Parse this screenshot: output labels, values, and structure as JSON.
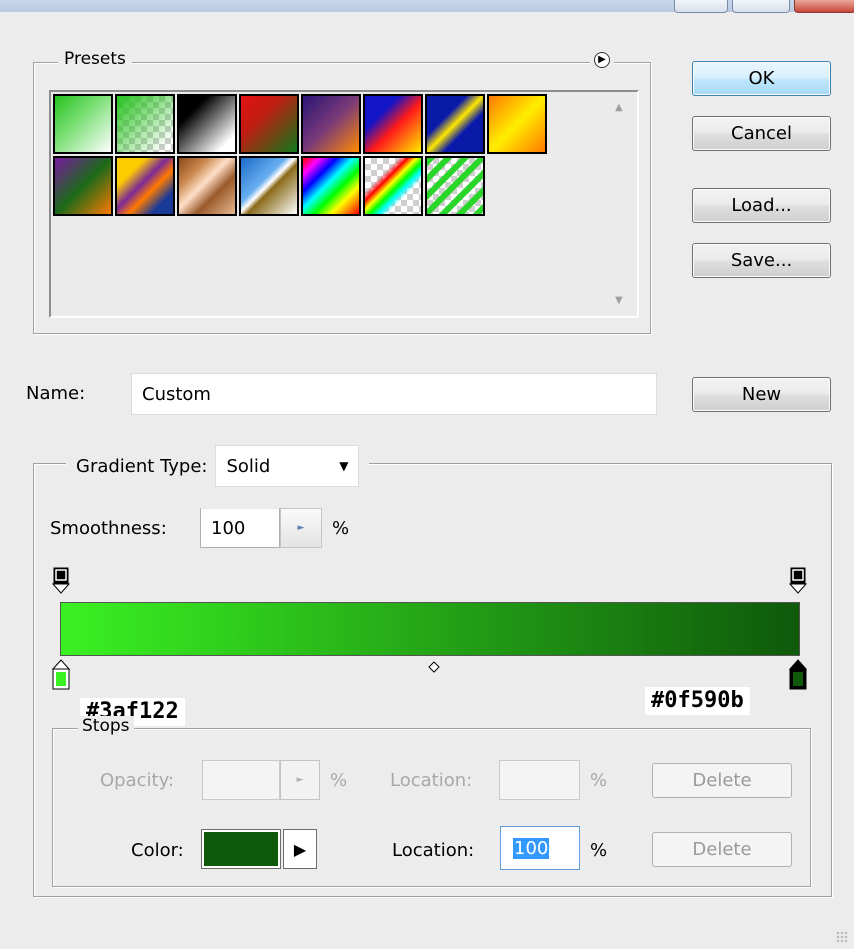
{
  "presets": {
    "legend": "Presets",
    "swatches": [
      {
        "name": "Foreground to Background",
        "css": "linear-gradient(135deg,#27c21f 0%,#7fe07a 45%,#ffffff 100%)"
      },
      {
        "name": "Foreground to Transparent",
        "css": "linear-gradient(135deg,#27c21f 0%,rgba(39,194,31,0) 90%), repeating-conic-gradient(#cfcfcf 0 25%,#ffffff 0 50%) 0 0/12px 12px"
      },
      {
        "name": "Black, White",
        "css": "linear-gradient(135deg,#000 0%,#000 25%,#fff 85%)"
      },
      {
        "name": "Red, Green",
        "css": "linear-gradient(135deg,#e31212 0%,#c31b12 35%,#0e7a1a 100%)"
      },
      {
        "name": "Violet, Orange",
        "css": "linear-gradient(135deg,#2a1478 0%,#7a3a78 50%,#ff8a00 100%)"
      },
      {
        "name": "Blue, Red, Yellow",
        "css": "linear-gradient(135deg,#1313c8 0%,#1313c8 30%,#ff1a1a 55%,#ffee00 100%)"
      },
      {
        "name": "Blue, Yellow, Blue",
        "css": "linear-gradient(135deg,#0a1aa8 0%,#0a1aa8 35%,#ffe600 50%,#0a1aa8 65%,#0a1aa8 100%)"
      },
      {
        "name": "Orange, Yellow, Orange",
        "css": "linear-gradient(135deg,#ff7a00 0%,#ffee00 50%,#ff7a00 100%)"
      },
      {
        "name": "Violet, Green, Orange",
        "css": "linear-gradient(135deg,#7a1aa0 0%,#1a6a1a 50%,#ff7a00 100%)"
      },
      {
        "name": "Yellow, Violet, Orange, Blue",
        "css": "linear-gradient(135deg,#ffcc00 0%,#ffcc00 25%,#7a2a98 45%,#ff7a00 60%,#1a3a98 80%,#1a3a98 100%)"
      },
      {
        "name": "Copper",
        "css": "linear-gradient(135deg,#8a4a1a 0%,#c8864a 25%,#ffe0c8 45%,#9a5a2a 65%,#e8b890 100%)"
      },
      {
        "name": "Chrome",
        "css": "linear-gradient(135deg,#1a6ac8 0%,#6ab0f0 40%,#ffffff 48%,#8a6a1a 55%,#ffffff 100%)"
      },
      {
        "name": "Spectrum",
        "css": "linear-gradient(135deg,#ff0000 0%,#ff00ff 15%,#0000ff 30%,#00ffff 45%,#00ff00 60%,#ffff00 75%,#ff0000 100%)"
      },
      {
        "name": "Transparent Rainbow",
        "css": "linear-gradient(135deg,rgba(255,0,0,0) 0%,rgba(255,0,0,0) 30%,#ff0000 38%,#ffff00 46%,#00ff00 54%,#00ffff 62%,rgba(0,0,255,0) 70%), repeating-conic-gradient(#cfcfcf 0 25%,#ffffff 0 50%) 0 0/12px 12px"
      },
      {
        "name": "Transparent Stripes",
        "css": "repeating-linear-gradient(135deg,#2ad62a 0 6px,rgba(255,255,255,0) 6px 12px), repeating-conic-gradient(#cfcfcf 0 25%,#ffffff 0 50%) 0 0/12px 12px"
      }
    ]
  },
  "buttons": {
    "ok": "OK",
    "cancel": "Cancel",
    "load": "Load...",
    "save": "Save...",
    "new": "New"
  },
  "name": {
    "label": "Name:",
    "value": "Custom"
  },
  "gradient": {
    "type_label": "Gradient Type:",
    "type_value": "Solid",
    "smoothness_label": "Smoothness:",
    "smoothness_value": "100",
    "smoothness_unit": "%",
    "start_color": "#3af122",
    "end_color": "#0f590b",
    "start_hex_label": "#3af122",
    "end_hex_label": "#0f590b",
    "midpoint": 0.5
  },
  "stops": {
    "legend": "Stops",
    "opacity_label": "Opacity:",
    "opacity_value": "",
    "opacity_unit": "%",
    "opacity_location_label": "Location:",
    "opacity_location_value": "",
    "opacity_location_unit": "%",
    "delete_label": "Delete",
    "color_label": "Color:",
    "color_value": "#0f590b",
    "color_location_label": "Location:",
    "color_location_value": "100",
    "color_location_unit": "%"
  }
}
